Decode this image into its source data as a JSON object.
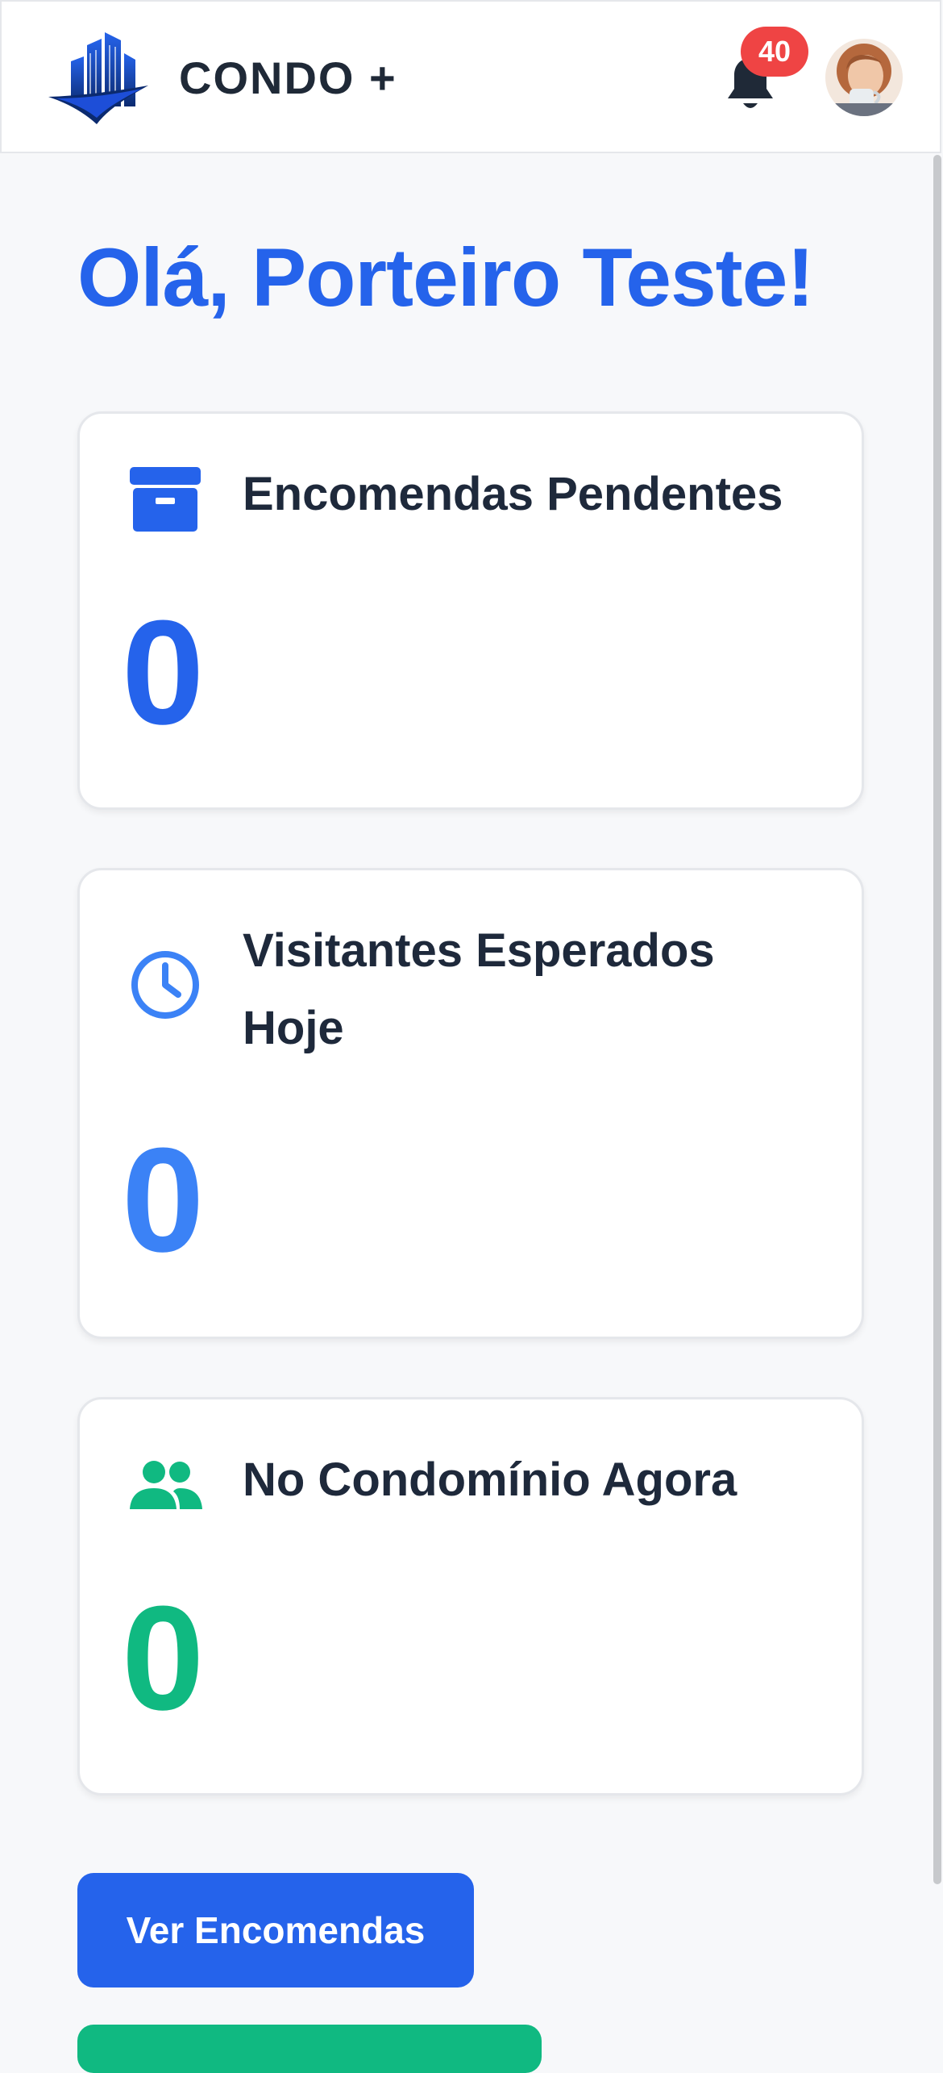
{
  "header": {
    "brand_name": "CONDO +",
    "notification_count": "40",
    "icons": {
      "logo": "building-logo",
      "bell": "bell-icon",
      "avatar": "user-avatar"
    }
  },
  "greeting": "Olá, Porteiro Teste!",
  "cards": [
    {
      "title": "Encomendas Pendentes",
      "value": "0",
      "icon": "archive-box-icon",
      "color": "#2563eb"
    },
    {
      "title": "Visitantes Esperados Hoje",
      "value": "0",
      "icon": "clock-icon",
      "color": "#3b82f6"
    },
    {
      "title": "No Condomínio Agora",
      "value": "0",
      "icon": "users-icon",
      "color": "#10b981"
    }
  ],
  "actions": {
    "primary_label": "Ver Encomendas"
  },
  "colors": {
    "primary": "#2563eb",
    "success": "#10b981",
    "badge": "#ef4444",
    "text": "#1e293b"
  }
}
